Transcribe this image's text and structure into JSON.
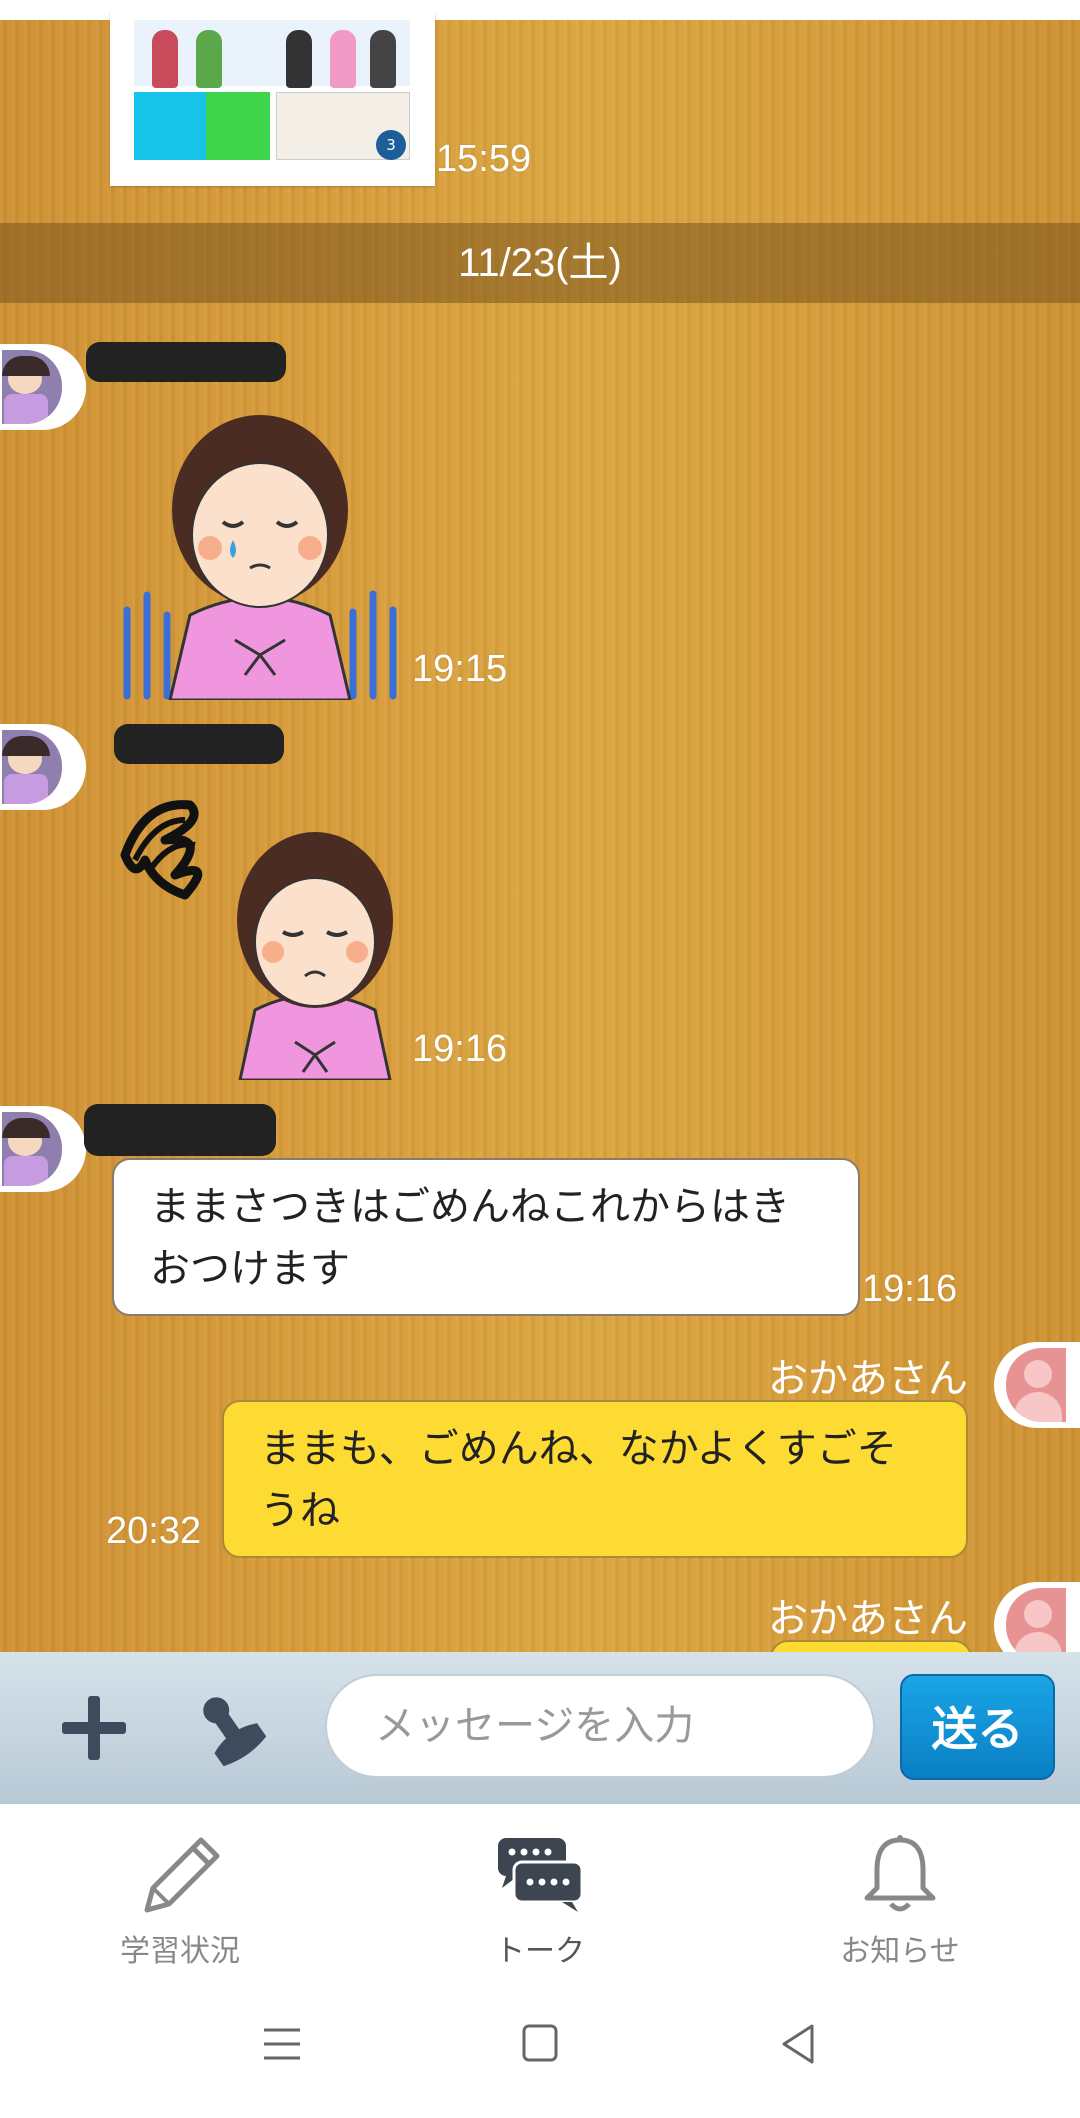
{
  "messages": {
    "top_time": "15:59",
    "thumb_badge": "3",
    "date_separator": "11/23(土)",
    "sticker1_time": "19:15",
    "sticker2_time": "19:16",
    "text_in": "ままさつきはごめんねこれからはきおつけます",
    "text_in_time": "19:16",
    "sender_out": "おかあさん",
    "text_out": "ままも、ごめんね、なかよくすごそうね",
    "text_out_time": "20:32",
    "sender_out2": "おかあさん"
  },
  "input_bar": {
    "placeholder": "メッセージを入力",
    "send_label": "送る"
  },
  "bottom_nav": {
    "items": [
      {
        "label": "学習状況",
        "icon": "pencil-icon"
      },
      {
        "label": "トーク",
        "icon": "chat-bubbles-icon"
      },
      {
        "label": "お知らせ",
        "icon": "bell-icon"
      }
    ],
    "active": "トーク"
  },
  "colors": {
    "chat_bg": "#d89c3a",
    "outgoing_bubble": "#fddb32",
    "send_button": "#1aa5e6"
  }
}
